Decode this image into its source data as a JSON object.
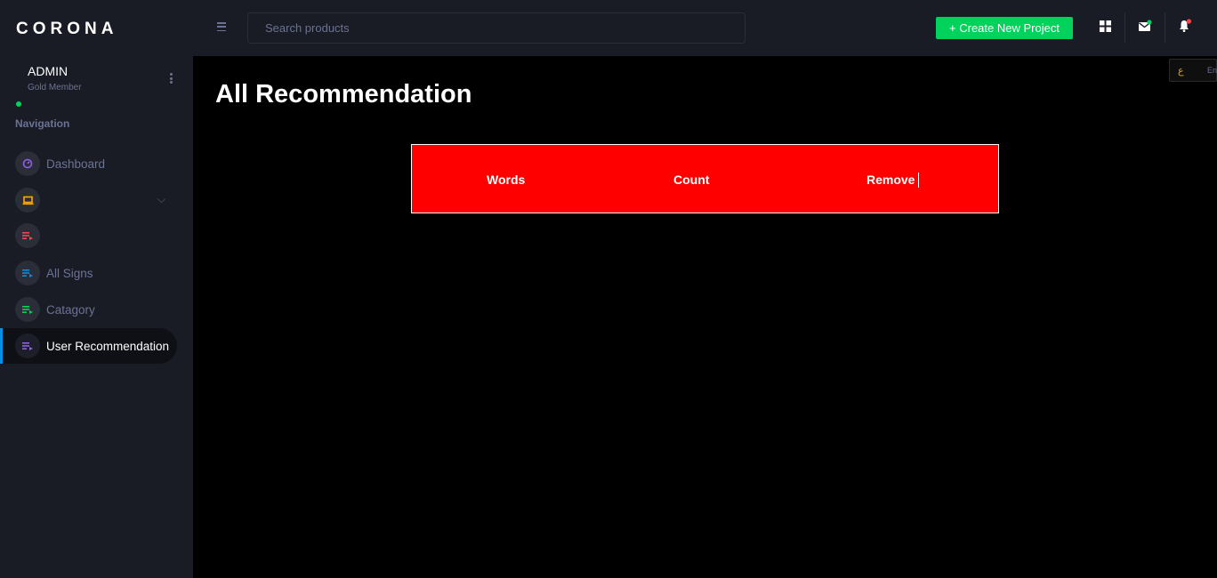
{
  "brand": "CORONA",
  "profile": {
    "name": "ADMIN",
    "role": "Gold Member"
  },
  "sidebar": {
    "heading": "Navigation",
    "items": [
      {
        "label": "Dashboard",
        "icon": "speedometer-icon",
        "color": "#8f5fe8"
      },
      {
        "label": "",
        "icon": "laptop-icon",
        "color": "#ffab00"
      },
      {
        "label": "",
        "icon": "playlist-icon",
        "color": "#fc424a"
      },
      {
        "label": "All Signs",
        "icon": "playlist-icon",
        "color": "#0090e7"
      },
      {
        "label": "Catagory",
        "icon": "playlist-icon",
        "color": "#00d25b"
      },
      {
        "label": "User Recommendation",
        "icon": "playlist-icon",
        "color": "#8f5fe8",
        "active": true
      }
    ]
  },
  "topbar": {
    "search_placeholder": "Search products",
    "create_label": "+ Create New Project"
  },
  "main": {
    "title": "All Recommendation",
    "table": {
      "headers": [
        "Words",
        "Count",
        "Remove"
      ]
    },
    "chip_text": "En"
  },
  "colors": {
    "accent_green": "#00d25b",
    "table_bg": "#ff0000",
    "sidebar_bg": "#191c24",
    "active_marker": "#0090e7",
    "notification_dot": "#fc424a"
  }
}
